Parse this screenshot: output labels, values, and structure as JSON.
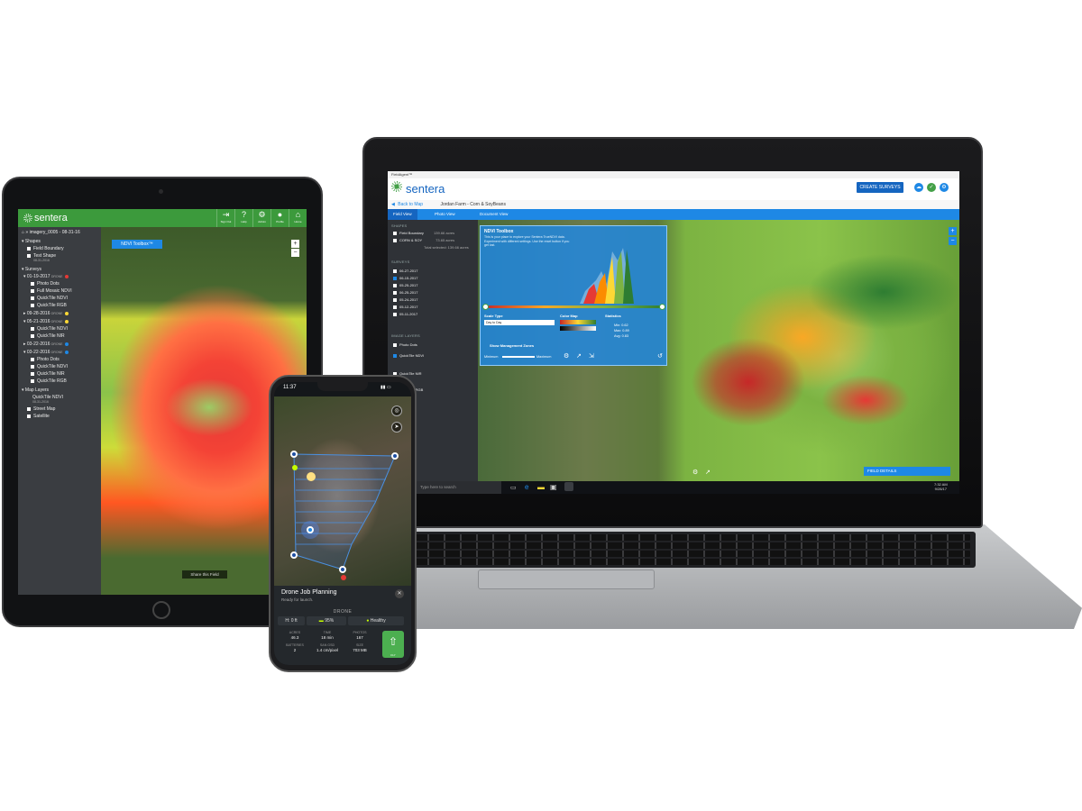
{
  "laptop": {
    "window_title": "FieldAgent™",
    "logo": "sentera",
    "create_surveys": "CREATE SURVEYS",
    "back_to_map": "Back to Map",
    "farm_title": "Jordan Farm - Corn & SoyBeans",
    "tabs": [
      "Field View",
      "Photo View",
      "Document View"
    ],
    "sections": {
      "shapes": "SHAPES",
      "surveys": "SURVEYS",
      "image_layers": "IMAGE LAYERS"
    },
    "shapes": [
      {
        "label": "Field Boundary",
        "value": "139.66 acres"
      },
      {
        "label": "CORN & SOY",
        "value": "73.65 acres"
      }
    ],
    "total_selected": "Total selected: 139.66 acres",
    "surveys": [
      "06-27-2017",
      "06-15-2017",
      "05-25-2017",
      "06-25-2017",
      "05-24-2017",
      "05-12-2017",
      "05-11-2017"
    ],
    "image_layers": [
      "Photo Dots",
      "QuickTile NDVI",
      "QuickTile NIR",
      "QuickTile RGB"
    ],
    "ndvi_toolbox": {
      "title": "NDVI Toolbox",
      "description": "This is your place to explore your Sentera TrueNDVI data. Experiment with different settings. Use the reset button if you get lost.",
      "scale_type": "Scale Type",
      "day_to_day": "Day to Day",
      "color_map": "Color Map",
      "statistics": "Statistics",
      "show_zones": "Show Management Zones",
      "minimum": "Minimum",
      "maximum": "Maximum",
      "stats": [
        {
          "label": "Min:",
          "value": "0.62"
        },
        {
          "label": "Max:",
          "value": "0.89"
        },
        {
          "label": "Avg:",
          "value": "0.83"
        }
      ]
    },
    "field_details": "FIELD DETAILS",
    "taskbar_search": "Type here to search",
    "clock_time": "7:32 AM",
    "clock_date": "9/28/17",
    "colors": {
      "accent": "#1e88e5",
      "brand_green": "#43a047"
    }
  },
  "tablet": {
    "logo": "sentera",
    "header_buttons": [
      {
        "icon": "sign-out-icon",
        "glyph": "⇥",
        "label": "Sign Out"
      },
      {
        "icon": "help-icon",
        "glyph": "?",
        "label": "Help"
      },
      {
        "icon": "gear-icon",
        "glyph": "⚙",
        "label": "Admin"
      },
      {
        "icon": "user-icon",
        "glyph": "●",
        "label": "Profile"
      },
      {
        "icon": "home-icon",
        "glyph": "⌂",
        "label": "Home"
      }
    ],
    "path": "imagery_0005 - 08-31-16",
    "shapes_header": "Shapes",
    "shapes": [
      {
        "label": "Field Boundary",
        "sub": ""
      },
      {
        "label": "Test Shape",
        "sub": "08-31-2016"
      }
    ],
    "surveys_header": "Surveys",
    "surveys": [
      {
        "label": "01-19-2017",
        "tag": "DRONE",
        "dot": "#e53935",
        "children": [
          "Photo Dots",
          "Full Mosaic NDVI",
          "QuickTile NDVI",
          "QuickTile RGB"
        ]
      },
      {
        "label": "09-28-2016",
        "tag": "DRONE",
        "dot": "#fdd835",
        "children": []
      },
      {
        "label": "05-21-2016",
        "tag": "DRONE",
        "dot": "#fdd835",
        "children": [
          "QuickTile NDVI",
          "QuickTile NIR"
        ]
      },
      {
        "label": "03-22-2016",
        "tag": "DRONE",
        "dot": "#1e88e5",
        "children": []
      },
      {
        "label": "03-22-2016",
        "tag": "DRONE",
        "dot": "#1e88e5",
        "children": [
          "Photo Dots",
          "QuickTile NDVI",
          "QuickTile NIR",
          "QuickTile RGB"
        ]
      }
    ],
    "map_layers_header": "Map Layers",
    "map_layers": [
      {
        "label": "QuickTile NDVI",
        "sub": "08-31-2016"
      },
      {
        "label": "Street Map",
        "sub": ""
      },
      {
        "label": "Satellite",
        "sub": ""
      }
    ],
    "ndvi_toolbox": "NDVI Toolbox™",
    "share_field": "Share this Field"
  },
  "phone": {
    "time": "11:37",
    "title": "Drone Job Planning",
    "subtitle": "Ready for launch.",
    "drone_label": "DRONE",
    "height": "H: 0 ft",
    "battery": "95%",
    "health": "Healthy",
    "stats": [
      {
        "label": "ACRES",
        "value": "46.3"
      },
      {
        "label": "TIME",
        "value": "18 min"
      },
      {
        "label": "PHOTOS",
        "value": "167"
      },
      {
        "label": "BATTERIES",
        "value": "2"
      },
      {
        "label": "SAN GSD",
        "value": "1.4 cm/pixel"
      },
      {
        "label": "SIZE",
        "value": "703 MB"
      }
    ],
    "launch_label": "FLY"
  }
}
